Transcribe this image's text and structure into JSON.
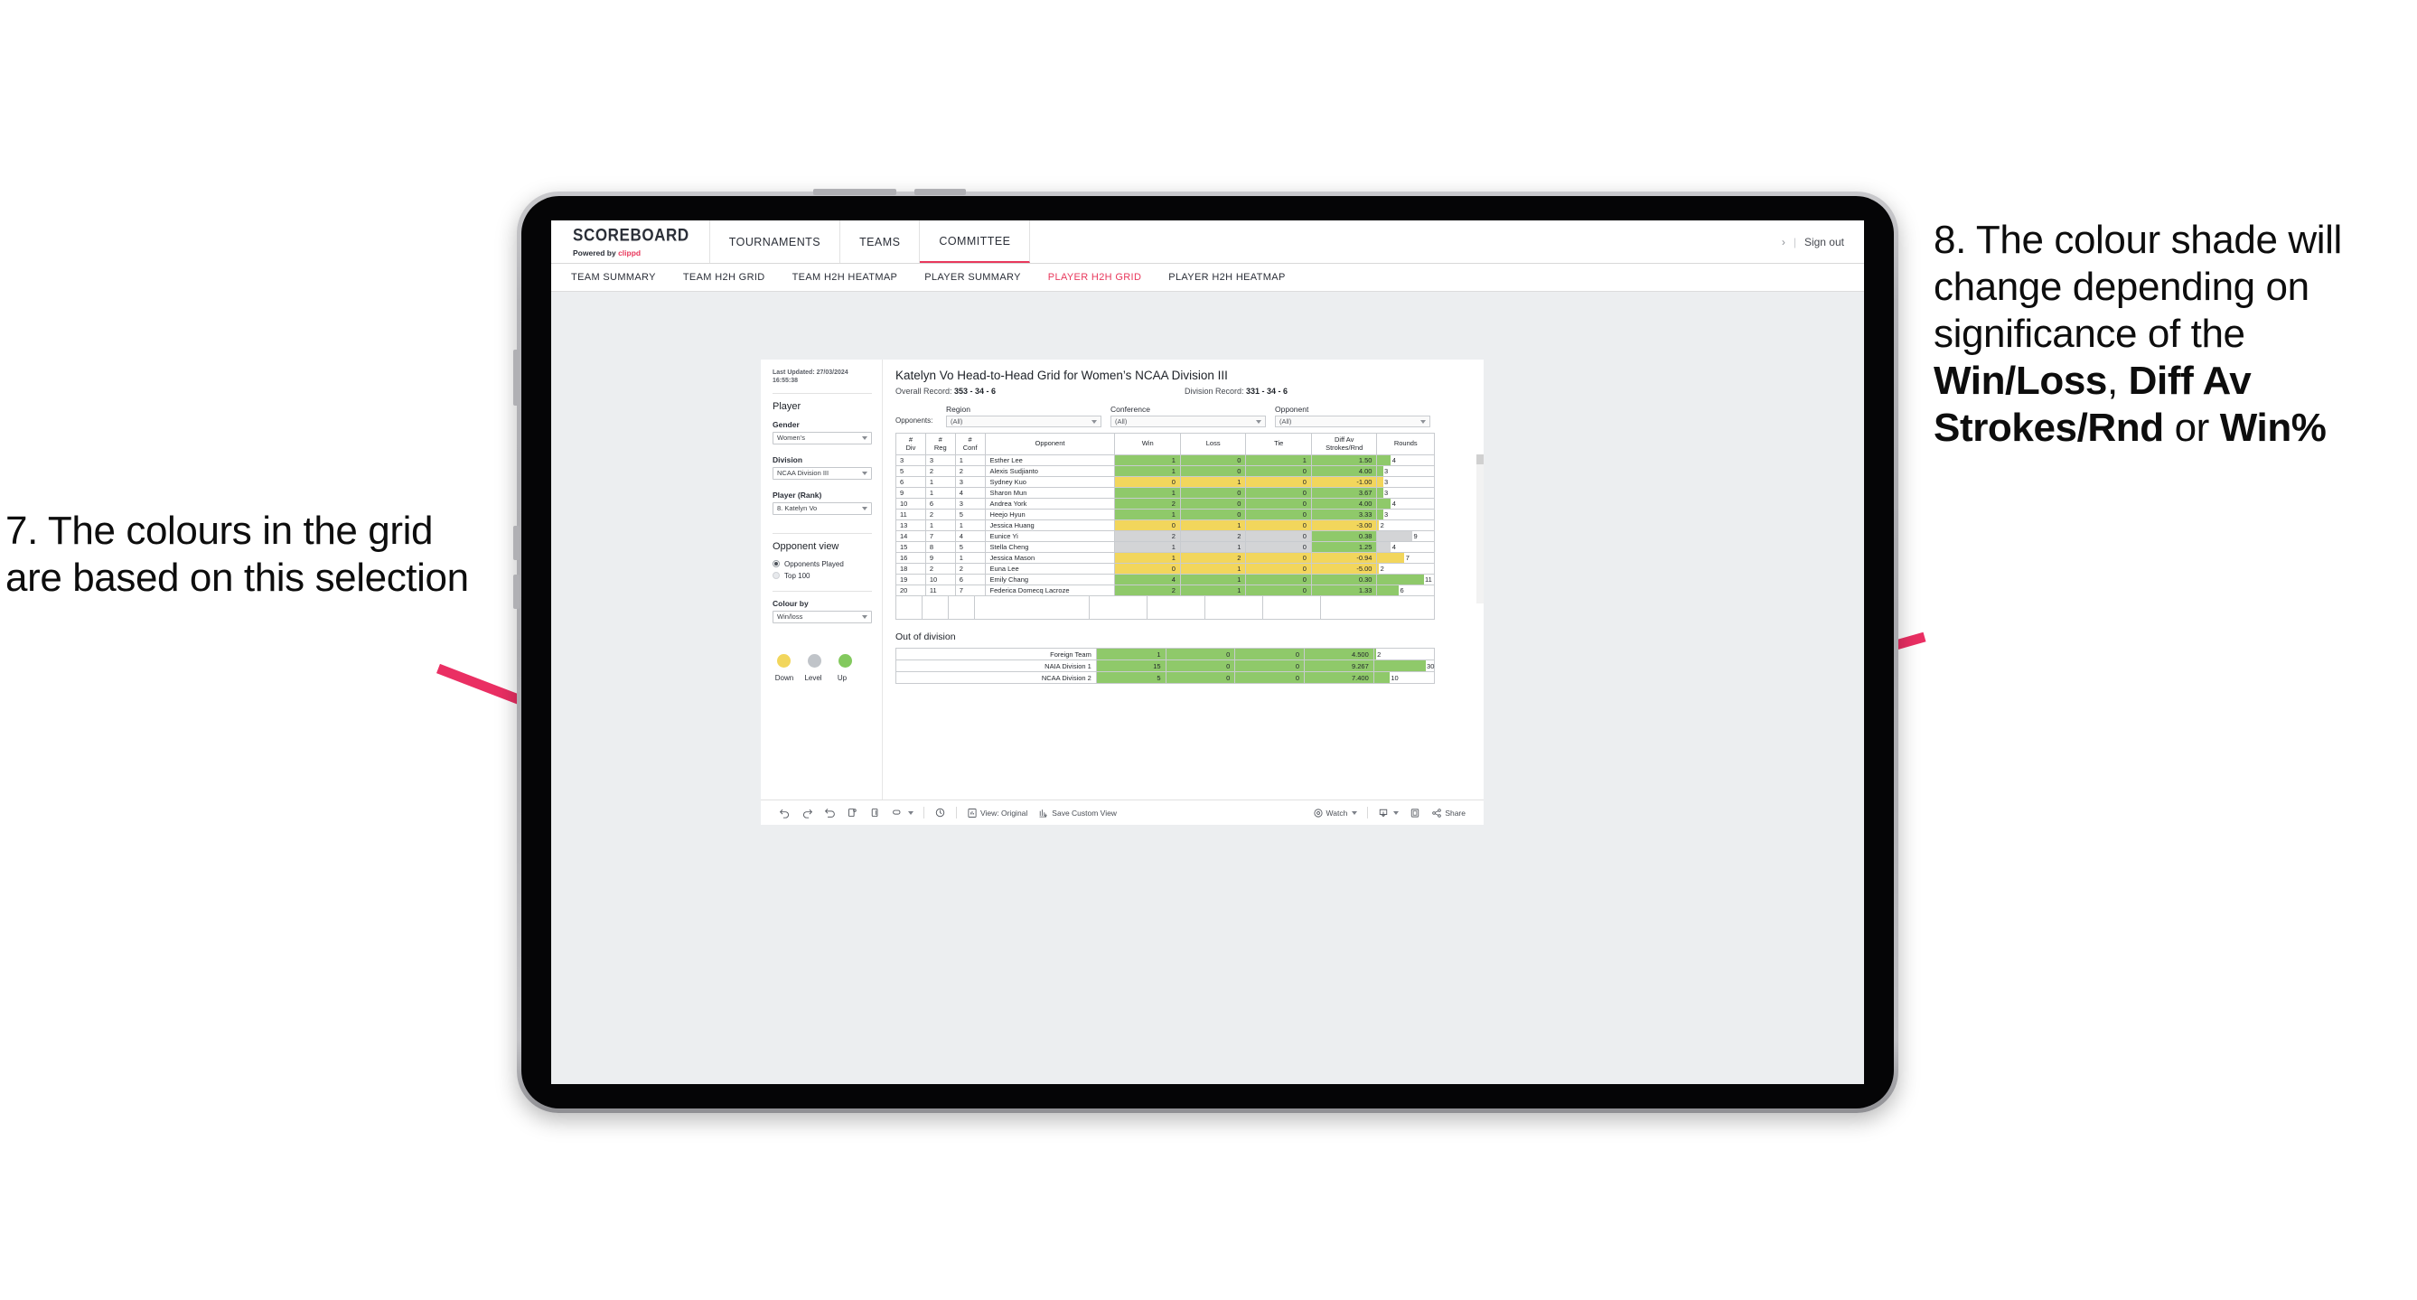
{
  "annotations": {
    "left": "7. The colours in the grid are based on this selection",
    "right_pre": "8. The colour shade will change depending on significance of the ",
    "right_b1": "Win/Loss",
    "right_mid1": ", ",
    "right_b2": "Diff Av Strokes/Rnd",
    "right_mid2": " or ",
    "right_b3": "Win%",
    "arrow_color": "#ea2f63"
  },
  "header": {
    "brand_name": "SCOREBOARD",
    "brand_sub_prefix": "Powered by ",
    "brand_sub_accent": "clippd",
    "nav": [
      {
        "label": "TOURNAMENTS",
        "active": false
      },
      {
        "label": "TEAMS",
        "active": false
      },
      {
        "label": "COMMITTEE",
        "active": true
      }
    ],
    "chevron": "›",
    "divider": "|",
    "sign_out": "Sign out"
  },
  "subtabs": [
    {
      "label": "TEAM SUMMARY",
      "active": false
    },
    {
      "label": "TEAM H2H GRID",
      "active": false
    },
    {
      "label": "TEAM H2H HEATMAP",
      "active": false
    },
    {
      "label": "PLAYER SUMMARY",
      "active": false
    },
    {
      "label": "PLAYER H2H GRID",
      "active": true
    },
    {
      "label": "PLAYER H2H HEATMAP",
      "active": false
    }
  ],
  "filters": {
    "last_updated": "Last Updated: 27/03/2024 16:55:38",
    "heading": "Player",
    "gender_label": "Gender",
    "gender_value": "Women’s",
    "division_label": "Division",
    "division_value": "NCAA Division III",
    "player_label": "Player (Rank)",
    "player_value": "8. Katelyn Vo",
    "opponent_view_heading": "Opponent view",
    "opponent_view_options": [
      {
        "label": "Opponents Played",
        "selected": true
      },
      {
        "label": "Top 100",
        "selected": false
      }
    ],
    "colour_by_label": "Colour by",
    "colour_by_value": "Win/loss",
    "legend": [
      {
        "label": "Down",
        "color": "#f2d65c"
      },
      {
        "label": "Level",
        "color": "#c0c4c9"
      },
      {
        "label": "Up",
        "color": "#83c95e"
      }
    ]
  },
  "content": {
    "title": "Katelyn Vo Head-to-Head Grid for Women’s NCAA Division III",
    "overall_record_label": "Overall Record: ",
    "overall_record_value": "353 -  34 - 6",
    "division_record_label": "Division Record: ",
    "division_record_value": "331 -  34 - 6",
    "opponents_lead": "Opponents:",
    "opponent_filters": [
      {
        "label": "Region",
        "value": "(All)"
      },
      {
        "label": "Conference",
        "value": "(All)"
      },
      {
        "label": "Opponent",
        "value": "(All)"
      }
    ],
    "grid_headers": [
      "#\nDiv",
      "#\nReg",
      "#\nConf",
      "Opponent",
      "Win",
      "Loss",
      "Tie",
      "Diff Av\nStrokes/Rnd",
      "Rounds"
    ],
    "grid_rows": [
      {
        "div": "3",
        "reg": "3",
        "conf": "1",
        "opponent": "Esther Lee",
        "win": "1",
        "loss": "0",
        "tie": "1",
        "diff": "1.50",
        "rounds": "4",
        "color": "green",
        "bar": 0.24
      },
      {
        "div": "5",
        "reg": "2",
        "conf": "2",
        "opponent": "Alexis Sudjianto",
        "win": "1",
        "loss": "0",
        "tie": "0",
        "diff": "4.00",
        "rounds": "3",
        "color": "green",
        "bar": 0.1
      },
      {
        "div": "6",
        "reg": "1",
        "conf": "3",
        "opponent": "Sydney Kuo",
        "win": "0",
        "loss": "1",
        "tie": "0",
        "diff": "-1.00",
        "rounds": "3",
        "color": "yellow",
        "bar": 0.1
      },
      {
        "div": "9",
        "reg": "1",
        "conf": "4",
        "opponent": "Sharon Mun",
        "win": "1",
        "loss": "0",
        "tie": "0",
        "diff": "3.67",
        "rounds": "3",
        "color": "green",
        "bar": 0.1
      },
      {
        "div": "10",
        "reg": "6",
        "conf": "3",
        "opponent": "Andrea York",
        "win": "2",
        "loss": "0",
        "tie": "0",
        "diff": "4.00",
        "rounds": "4",
        "color": "green",
        "bar": 0.24
      },
      {
        "div": "11",
        "reg": "2",
        "conf": "5",
        "opponent": "Heejo Hyun",
        "win": "1",
        "loss": "0",
        "tie": "0",
        "diff": "3.33",
        "rounds": "3",
        "color": "green",
        "bar": 0.1
      },
      {
        "div": "13",
        "reg": "1",
        "conf": "1",
        "opponent": "Jessica Huang",
        "win": "0",
        "loss": "1",
        "tie": "0",
        "diff": "-3.00",
        "rounds": "2",
        "color": "yellow",
        "bar": 0.03
      },
      {
        "div": "14",
        "reg": "7",
        "conf": "4",
        "opponent": "Eunice Yi",
        "win": "2",
        "loss": "2",
        "tie": "0",
        "diff": "0.38",
        "rounds": "9",
        "color": "grey",
        "bar": 0.62
      },
      {
        "div": "15",
        "reg": "8",
        "conf": "5",
        "opponent": "Stella Cheng",
        "win": "1",
        "loss": "1",
        "tie": "0",
        "diff": "1.25",
        "rounds": "4",
        "color": "grey",
        "bar": 0.24
      },
      {
        "div": "16",
        "reg": "9",
        "conf": "1",
        "opponent": "Jessica Mason",
        "win": "1",
        "loss": "2",
        "tie": "0",
        "diff": "-0.94",
        "rounds": "7",
        "color": "yellow",
        "bar": 0.48
      },
      {
        "div": "18",
        "reg": "2",
        "conf": "2",
        "opponent": "Euna Lee",
        "win": "0",
        "loss": "1",
        "tie": "0",
        "diff": "-5.00",
        "rounds": "2",
        "color": "yellow",
        "bar": 0.03
      },
      {
        "div": "19",
        "reg": "10",
        "conf": "6",
        "opponent": "Emily Chang",
        "win": "4",
        "loss": "1",
        "tie": "0",
        "diff": "0.30",
        "rounds": "11",
        "color": "green",
        "bar": 0.82
      },
      {
        "div": "20",
        "reg": "11",
        "conf": "7",
        "opponent": "Federica Domecq Lacroze",
        "win": "2",
        "loss": "1",
        "tie": "0",
        "diff": "1.33",
        "rounds": "6",
        "color": "green",
        "bar": 0.38
      }
    ],
    "ood_title": "Out of division",
    "ood_rows": [
      {
        "name": "Foreign Team",
        "win": "1",
        "loss": "0",
        "tie": "0",
        "diff": "4.500",
        "rounds": "2",
        "color": "green",
        "bar": 0.03
      },
      {
        "name": "NAIA Division 1",
        "win": "15",
        "loss": "0",
        "tie": "0",
        "diff": "9.267",
        "rounds": "30",
        "color": "green",
        "bar": 0.86
      },
      {
        "name": "NCAA Division 2",
        "win": "5",
        "loss": "0",
        "tie": "0",
        "diff": "7.400",
        "rounds": "10",
        "color": "green",
        "bar": 0.26
      }
    ]
  },
  "toolbar": {
    "view_original": "View: Original",
    "save_custom_view": "Save Custom View",
    "watch": "Watch",
    "share": "Share"
  },
  "colors": {
    "green": "#8fc96a",
    "yellow": "#f2d65c",
    "grey": "#d3d4d6",
    "accent_pink": "#e8385c"
  }
}
